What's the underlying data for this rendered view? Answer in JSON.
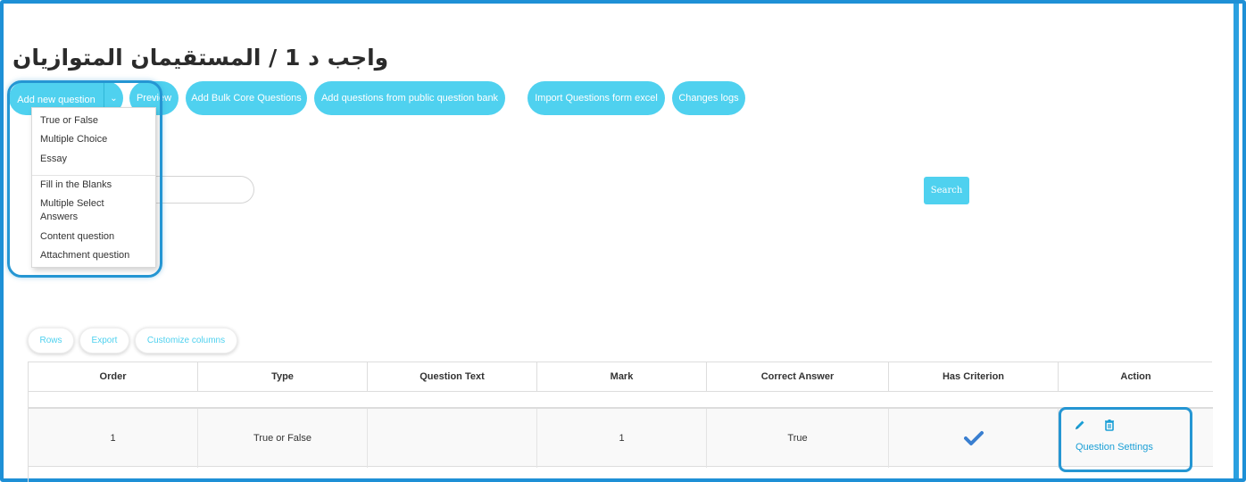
{
  "page": {
    "title": "واجب د 1 / المستقيمان المتوازيان"
  },
  "toolbar": {
    "add_new": "Add new question",
    "preview": "Preview",
    "bulk": "Add Bulk Core Questions",
    "public_bank": "Add questions from public question bank",
    "import_excel": "Import Questions form excel",
    "changes_logs": "Changes logs"
  },
  "dropdown": {
    "items": [
      "True or False",
      "Multiple Choice",
      "Essay",
      "Fill in the Blanks",
      "Multiple Select Answers",
      "Content question",
      "Attachment question"
    ]
  },
  "search": {
    "button": "Search",
    "value": ""
  },
  "table_tools": {
    "rows": "Rows",
    "export": "Export",
    "customize": "Customize columns"
  },
  "table": {
    "headers": [
      "Order",
      "Type",
      "Question Text",
      "Mark",
      "Correct Answer",
      "Has Criterion",
      "Action"
    ],
    "rows": [
      {
        "order": "1",
        "type": "True or False",
        "question_text": "",
        "mark": "1",
        "correct_answer": "True",
        "has_criterion": true,
        "settings_label": "Question Settings"
      }
    ]
  },
  "icons": {
    "caret": "chevron-down-icon",
    "check": "check-icon",
    "edit": "pencil-icon",
    "delete": "trash-icon"
  },
  "colors": {
    "accent": "#4fd1ef",
    "highlight": "#2596d3",
    "check": "#3a7fd0",
    "link": "#1a9fd6"
  }
}
